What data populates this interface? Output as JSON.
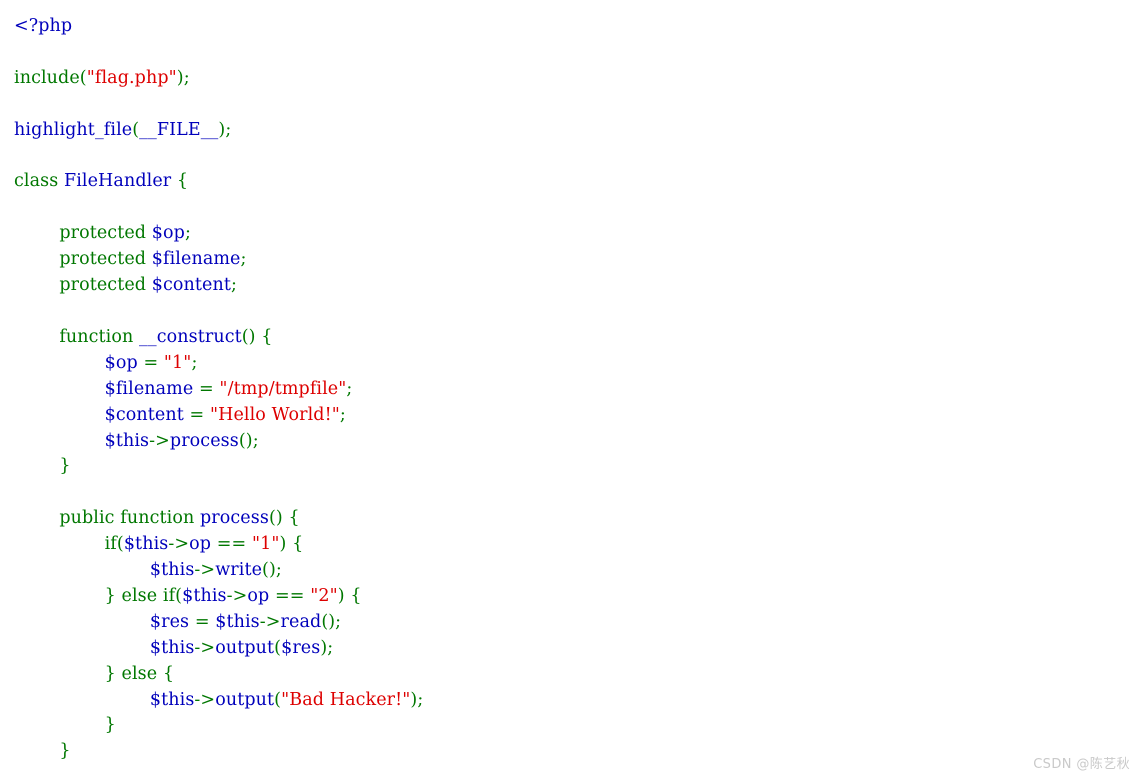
{
  "page": {
    "background": "#ffffff",
    "language": "php",
    "renderer": "highlight_file"
  },
  "palette": {
    "default": "#0000BB",
    "keyword": "#007700",
    "string": "#DD0000",
    "comment": "#FF8000",
    "watermark": "#c9c9c9"
  },
  "watermark": {
    "text": "CSDN @陈艺秋"
  },
  "code": {
    "raw": "<?php\n\ninclude(\"flag.php\");\n\nhighlight_file(__FILE__);\n\nclass FileHandler {\n\n    protected $op;\n    protected $filename;\n    protected $content;\n\n    function __construct() {\n        $op = \"1\";\n        $filename = \"/tmp/tmpfile\";\n        $content = \"Hello World!\";\n        $this->process();\n    }\n\n    public function process() {\n        if($this->op == \"1\") {\n            $this->write();\n        } else if($this->op == \"2\") {\n            $res = $this->read();\n            $this->output($res);\n        } else {\n            $this->output(\"Bad Hacker!\");\n        }\n    }",
    "lines": [
      {
        "n": 1,
        "indent": 0,
        "tokens": [
          {
            "t": "<?php",
            "c": "default"
          }
        ]
      },
      {
        "n": 2,
        "indent": 0,
        "tokens": []
      },
      {
        "n": 3,
        "indent": 0,
        "tokens": [
          {
            "t": "include",
            "c": "keyword"
          },
          {
            "t": "(",
            "c": "keyword"
          },
          {
            "t": "\"flag.php\"",
            "c": "string"
          },
          {
            "t": ")",
            "c": "keyword"
          },
          {
            "t": ";",
            "c": "keyword"
          }
        ]
      },
      {
        "n": 4,
        "indent": 0,
        "tokens": []
      },
      {
        "n": 5,
        "indent": 0,
        "tokens": [
          {
            "t": "highlight_file",
            "c": "default"
          },
          {
            "t": "(",
            "c": "keyword"
          },
          {
            "t": "__FILE__",
            "c": "default"
          },
          {
            "t": ")",
            "c": "keyword"
          },
          {
            "t": ";",
            "c": "keyword"
          }
        ]
      },
      {
        "n": 6,
        "indent": 0,
        "tokens": []
      },
      {
        "n": 7,
        "indent": 0,
        "tokens": [
          {
            "t": "class",
            "c": "keyword"
          },
          {
            "t": " ",
            "c": "keyword"
          },
          {
            "t": "FileHandler",
            "c": "default"
          },
          {
            "t": " ",
            "c": "keyword"
          },
          {
            "t": "{",
            "c": "keyword"
          }
        ]
      },
      {
        "n": 8,
        "indent": 0,
        "tokens": []
      },
      {
        "n": 9,
        "indent": 1,
        "tokens": [
          {
            "t": "protected",
            "c": "keyword"
          },
          {
            "t": " ",
            "c": "keyword"
          },
          {
            "t": "$op",
            "c": "default"
          },
          {
            "t": ";",
            "c": "keyword"
          }
        ]
      },
      {
        "n": 10,
        "indent": 1,
        "tokens": [
          {
            "t": "protected",
            "c": "keyword"
          },
          {
            "t": " ",
            "c": "keyword"
          },
          {
            "t": "$filename",
            "c": "default"
          },
          {
            "t": ";",
            "c": "keyword"
          }
        ]
      },
      {
        "n": 11,
        "indent": 1,
        "tokens": [
          {
            "t": "protected",
            "c": "keyword"
          },
          {
            "t": " ",
            "c": "keyword"
          },
          {
            "t": "$content",
            "c": "default"
          },
          {
            "t": ";",
            "c": "keyword"
          }
        ]
      },
      {
        "n": 12,
        "indent": 0,
        "tokens": []
      },
      {
        "n": 13,
        "indent": 1,
        "tokens": [
          {
            "t": "function",
            "c": "keyword"
          },
          {
            "t": " ",
            "c": "keyword"
          },
          {
            "t": "__construct",
            "c": "default"
          },
          {
            "t": "()",
            "c": "keyword"
          },
          {
            "t": " ",
            "c": "keyword"
          },
          {
            "t": "{",
            "c": "keyword"
          }
        ]
      },
      {
        "n": 14,
        "indent": 2,
        "tokens": [
          {
            "t": "$op",
            "c": "default"
          },
          {
            "t": " = ",
            "c": "keyword"
          },
          {
            "t": "\"1\"",
            "c": "string"
          },
          {
            "t": ";",
            "c": "keyword"
          }
        ]
      },
      {
        "n": 15,
        "indent": 2,
        "tokens": [
          {
            "t": "$filename",
            "c": "default"
          },
          {
            "t": " = ",
            "c": "keyword"
          },
          {
            "t": "\"/tmp/tmpfile\"",
            "c": "string"
          },
          {
            "t": ";",
            "c": "keyword"
          }
        ]
      },
      {
        "n": 16,
        "indent": 2,
        "tokens": [
          {
            "t": "$content",
            "c": "default"
          },
          {
            "t": " = ",
            "c": "keyword"
          },
          {
            "t": "\"Hello World!\"",
            "c": "string"
          },
          {
            "t": ";",
            "c": "keyword"
          }
        ]
      },
      {
        "n": 17,
        "indent": 2,
        "tokens": [
          {
            "t": "$this",
            "c": "default"
          },
          {
            "t": "->",
            "c": "keyword"
          },
          {
            "t": "process",
            "c": "default"
          },
          {
            "t": "()",
            "c": "keyword"
          },
          {
            "t": ";",
            "c": "keyword"
          }
        ]
      },
      {
        "n": 18,
        "indent": 1,
        "tokens": [
          {
            "t": "}",
            "c": "keyword"
          }
        ]
      },
      {
        "n": 19,
        "indent": 0,
        "tokens": []
      },
      {
        "n": 20,
        "indent": 1,
        "tokens": [
          {
            "t": "public",
            "c": "keyword"
          },
          {
            "t": " ",
            "c": "keyword"
          },
          {
            "t": "function",
            "c": "keyword"
          },
          {
            "t": " ",
            "c": "keyword"
          },
          {
            "t": "process",
            "c": "default"
          },
          {
            "t": "()",
            "c": "keyword"
          },
          {
            "t": " ",
            "c": "keyword"
          },
          {
            "t": "{",
            "c": "keyword"
          }
        ]
      },
      {
        "n": 21,
        "indent": 2,
        "tokens": [
          {
            "t": "if",
            "c": "keyword"
          },
          {
            "t": "(",
            "c": "keyword"
          },
          {
            "t": "$this",
            "c": "default"
          },
          {
            "t": "->",
            "c": "keyword"
          },
          {
            "t": "op",
            "c": "default"
          },
          {
            "t": " == ",
            "c": "keyword"
          },
          {
            "t": "\"1\"",
            "c": "string"
          },
          {
            "t": ")",
            "c": "keyword"
          },
          {
            "t": " ",
            "c": "keyword"
          },
          {
            "t": "{",
            "c": "keyword"
          }
        ]
      },
      {
        "n": 22,
        "indent": 3,
        "tokens": [
          {
            "t": "$this",
            "c": "default"
          },
          {
            "t": "->",
            "c": "keyword"
          },
          {
            "t": "write",
            "c": "default"
          },
          {
            "t": "()",
            "c": "keyword"
          },
          {
            "t": ";",
            "c": "keyword"
          }
        ]
      },
      {
        "n": 23,
        "indent": 2,
        "tokens": [
          {
            "t": "}",
            "c": "keyword"
          },
          {
            "t": " ",
            "c": "keyword"
          },
          {
            "t": "else",
            "c": "keyword"
          },
          {
            "t": " ",
            "c": "keyword"
          },
          {
            "t": "if",
            "c": "keyword"
          },
          {
            "t": "(",
            "c": "keyword"
          },
          {
            "t": "$this",
            "c": "default"
          },
          {
            "t": "->",
            "c": "keyword"
          },
          {
            "t": "op",
            "c": "default"
          },
          {
            "t": " == ",
            "c": "keyword"
          },
          {
            "t": "\"2\"",
            "c": "string"
          },
          {
            "t": ")",
            "c": "keyword"
          },
          {
            "t": " ",
            "c": "keyword"
          },
          {
            "t": "{",
            "c": "keyword"
          }
        ]
      },
      {
        "n": 24,
        "indent": 3,
        "tokens": [
          {
            "t": "$res",
            "c": "default"
          },
          {
            "t": " = ",
            "c": "keyword"
          },
          {
            "t": "$this",
            "c": "default"
          },
          {
            "t": "->",
            "c": "keyword"
          },
          {
            "t": "read",
            "c": "default"
          },
          {
            "t": "()",
            "c": "keyword"
          },
          {
            "t": ";",
            "c": "keyword"
          }
        ]
      },
      {
        "n": 25,
        "indent": 3,
        "tokens": [
          {
            "t": "$this",
            "c": "default"
          },
          {
            "t": "->",
            "c": "keyword"
          },
          {
            "t": "output",
            "c": "default"
          },
          {
            "t": "(",
            "c": "keyword"
          },
          {
            "t": "$res",
            "c": "default"
          },
          {
            "t": ")",
            "c": "keyword"
          },
          {
            "t": ";",
            "c": "keyword"
          }
        ]
      },
      {
        "n": 26,
        "indent": 2,
        "tokens": [
          {
            "t": "}",
            "c": "keyword"
          },
          {
            "t": " ",
            "c": "keyword"
          },
          {
            "t": "else",
            "c": "keyword"
          },
          {
            "t": " ",
            "c": "keyword"
          },
          {
            "t": "{",
            "c": "keyword"
          }
        ]
      },
      {
        "n": 27,
        "indent": 3,
        "tokens": [
          {
            "t": "$this",
            "c": "default"
          },
          {
            "t": "->",
            "c": "keyword"
          },
          {
            "t": "output",
            "c": "default"
          },
          {
            "t": "(",
            "c": "keyword"
          },
          {
            "t": "\"Bad Hacker!\"",
            "c": "string"
          },
          {
            "t": ")",
            "c": "keyword"
          },
          {
            "t": ";",
            "c": "keyword"
          }
        ]
      },
      {
        "n": 28,
        "indent": 2,
        "tokens": [
          {
            "t": "}",
            "c": "keyword"
          }
        ]
      },
      {
        "n": 29,
        "indent": 1,
        "tokens": [
          {
            "t": "}",
            "c": "keyword"
          }
        ]
      }
    ]
  }
}
